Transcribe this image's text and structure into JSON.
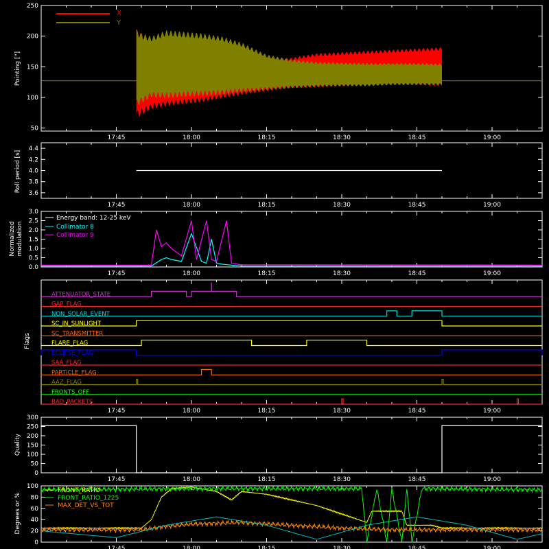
{
  "chart_data": [
    {
      "type": "area",
      "ylabel": "Pointing [\"]",
      "ylim": [
        45,
        250
      ],
      "yticks": [
        "50",
        "100",
        "150",
        "200",
        "250"
      ],
      "x_ticks": [
        "17:45",
        "18:00",
        "18:15",
        "18:30",
        "18:45",
        "19:00"
      ],
      "baseline": 127,
      "legend": [
        {
          "name": "X",
          "color": "#ff0000"
        },
        {
          "name": "Y",
          "color": "#808000"
        }
      ],
      "series": [
        {
          "name": "X",
          "color": "#ff0000",
          "x": [
            "17:49",
            "17:50",
            "17:52",
            "17:55",
            "17:58",
            "18:02",
            "18:06",
            "18:10",
            "18:15",
            "18:20",
            "18:25",
            "18:30",
            "18:35",
            "18:40",
            "18:45",
            "18:50"
          ],
          "upper": [
            210,
            205,
            195,
            192,
            188,
            182,
            178,
            172,
            162,
            165,
            172,
            174,
            176,
            178,
            180,
            182
          ],
          "lower": [
            65,
            70,
            80,
            85,
            88,
            92,
            98,
            104,
            110,
            115,
            116,
            118,
            120,
            120,
            120,
            118
          ]
        },
        {
          "name": "Y",
          "color": "#808000",
          "x": [
            "17:49",
            "17:50",
            "17:52",
            "17:55",
            "17:58",
            "18:02",
            "18:06",
            "18:10",
            "18:15",
            "18:20",
            "18:25",
            "18:30",
            "18:35",
            "18:40",
            "18:45",
            "18:50"
          ],
          "upper": [
            212,
            205,
            200,
            210,
            208,
            205,
            200,
            190,
            170,
            162,
            158,
            157,
            156,
            156,
            156,
            155
          ],
          "lower": [
            85,
            90,
            100,
            98,
            100,
            102,
            104,
            108,
            112,
            115,
            117,
            118,
            118,
            120,
            120,
            120
          ]
        }
      ]
    },
    {
      "type": "line",
      "ylabel": "Roll period [s]",
      "ylim": [
        3.5,
        4.5
      ],
      "yticks": [
        "3.6",
        "3.8",
        "4.0",
        "4.2",
        "4.4"
      ],
      "x_ticks": [
        "17:45",
        "18:00",
        "18:15",
        "18:30",
        "18:45",
        "19:00"
      ],
      "series": [
        {
          "color": "#ffffff",
          "x": [
            "17:49",
            "18:50"
          ],
          "y": [
            4.0,
            4.0
          ]
        }
      ]
    },
    {
      "type": "line",
      "ylabel": "Normalized modulation",
      "ylim": [
        0.0,
        3.0
      ],
      "yticks": [
        "0.0",
        "0.5",
        "1.0",
        "1.5",
        "2.0",
        "2.5",
        "3.0"
      ],
      "x_ticks": [
        "17:45",
        "18:00",
        "18:15",
        "18:30",
        "18:45",
        "19:00"
      ],
      "legend_title": "Energy band: 12-25 keV",
      "series": [
        {
          "name": "Collimator 8",
          "color": "#00ffff",
          "x": [
            "17:30",
            "17:52",
            "17:54",
            "17:55",
            "17:56",
            "17:58",
            "18:00",
            "18:02",
            "18:03",
            "18:04",
            "18:05",
            "18:06",
            "18:08",
            "18:10",
            "19:10"
          ],
          "y": [
            0.05,
            0.05,
            0.4,
            0.5,
            0.4,
            0.3,
            1.8,
            0.3,
            0.2,
            1.5,
            0.2,
            0.15,
            0.1,
            0.05,
            0.05
          ]
        },
        {
          "name": "Collimator 9",
          "color": "#ff00ff",
          "x": [
            "17:30",
            "17:52",
            "17:53",
            "17:54",
            "17:55",
            "17:56",
            "17:58",
            "18:00",
            "18:01",
            "18:03",
            "18:04",
            "18:05",
            "18:07",
            "18:08",
            "18:10",
            "19:10"
          ],
          "y": [
            0.1,
            0.1,
            2.0,
            1.1,
            1.3,
            1.0,
            0.6,
            2.5,
            0.4,
            2.5,
            0.4,
            0.3,
            2.5,
            0.2,
            0.12,
            0.1
          ]
        }
      ]
    },
    {
      "type": "table",
      "ylabel": "Flags",
      "x_ticks": [
        "17:45",
        "18:00",
        "18:15",
        "18:30",
        "18:45",
        "19:00"
      ],
      "flags": [
        {
          "label": "ATTENUATOR_STATE",
          "color": "#cc33cc",
          "on": [
            [
              "17:52",
              "17:59"
            ],
            [
              "18:00",
              "18:09"
            ]
          ],
          "step_up": [
            [
              "18:04",
              "18:04"
            ]
          ]
        },
        {
          "label": "GAP_FLAG",
          "color": "#ff2222",
          "on": []
        },
        {
          "label": "NON_SOLAR_EVENT",
          "color": "#00dddd",
          "on": [
            [
              "18:39",
              "18:41"
            ],
            [
              "18:44",
              "18:50"
            ]
          ]
        },
        {
          "label": "SC_IN_SUNLIGHT",
          "color": "#ffff00",
          "on": [
            [
              "17:49",
              "18:50"
            ]
          ]
        },
        {
          "label": "SC_TRANSMITTER",
          "color": "#ff6600",
          "on": []
        },
        {
          "label": "FLARE_FLAG",
          "color": "#ffff00",
          "on": [
            [
              "17:50",
              "18:12"
            ],
            [
              "18:23",
              "18:35"
            ]
          ]
        },
        {
          "label": "ECLIPSE_FLAG",
          "color": "#0000ff",
          "on": [
            [
              "17:30",
              "17:49"
            ],
            [
              "18:50",
              "19:10"
            ]
          ]
        },
        {
          "label": "SAA_FLAG",
          "color": "#ff2222",
          "on": []
        },
        {
          "label": "PARTICLE_FLAG",
          "color": "#ff6600",
          "on": [
            [
              "18:02",
              "18:04"
            ]
          ]
        },
        {
          "label": "AAZ_FLAG",
          "color": "#808000",
          "on": [
            [
              "17:49",
              "17:49"
            ],
            [
              "18:50",
              "18:50"
            ]
          ]
        },
        {
          "label": "FRONTS_OFF",
          "color": "#00ff00",
          "on": []
        },
        {
          "label": "BAD_PACKETS",
          "color": "#ff2222",
          "on": [
            [
              "18:30",
              "18:30"
            ],
            [
              "19:05",
              "19:05"
            ]
          ]
        }
      ]
    },
    {
      "type": "line",
      "ylabel": "Quality",
      "ylim": [
        0,
        300
      ],
      "yticks": [
        "0",
        "50",
        "100",
        "150",
        "200",
        "250",
        "300"
      ],
      "x_ticks": [
        "17:45",
        "18:00",
        "18:15",
        "18:30",
        "18:45",
        "19:00"
      ],
      "series": [
        {
          "color": "#ffffff",
          "x": [
            "17:30",
            "17:49",
            "17:49",
            "18:50",
            "18:50",
            "19:10"
          ],
          "y": [
            255,
            255,
            0,
            0,
            255,
            255
          ]
        }
      ]
    },
    {
      "type": "line",
      "ylabel": "Degrees or %",
      "ylim": [
        0,
        100
      ],
      "yticks": [
        "0",
        "20",
        "40",
        "60",
        "80",
        "100"
      ],
      "x_ticks": [
        "17:45",
        "18:00",
        "18:15",
        "18:30",
        "18:45",
        "19:00"
      ],
      "series": [
        {
          "name": "FRONT_RATIO",
          "color": "#ffff00",
          "x": [
            "17:30",
            "17:50",
            "17:52",
            "17:54",
            "17:56",
            "18:00",
            "18:05",
            "18:08",
            "18:10",
            "18:15",
            "18:20",
            "18:25",
            "18:30",
            "18:35",
            "18:36",
            "18:42",
            "18:43",
            "18:48",
            "18:50",
            "19:10"
          ],
          "y": [
            25,
            25,
            40,
            80,
            95,
            98,
            90,
            75,
            90,
            85,
            75,
            65,
            50,
            35,
            55,
            55,
            30,
            30,
            25,
            25
          ]
        },
        {
          "name": "FRONT_RATIO_1225",
          "color": "#00ff00",
          "x": [
            "17:30",
            "18:00",
            "18:34",
            "18:35",
            "18:37",
            "18:39",
            "18:40",
            "18:42",
            "18:43",
            "18:44",
            "18:46",
            "19:10"
          ],
          "y": [
            93,
            95,
            95,
            0,
            95,
            0,
            95,
            0,
            95,
            0,
            95,
            93
          ]
        },
        {
          "name": "MAX_DET_VS_TOT",
          "color": "#ff8800",
          "x": [
            "17:30",
            "17:50",
            "17:55",
            "18:00",
            "18:10",
            "18:20",
            "18:30",
            "18:40",
            "18:50",
            "19:10"
          ],
          "y": [
            22,
            22,
            28,
            32,
            35,
            30,
            25,
            22,
            22,
            22
          ]
        },
        {
          "color": "#00bbbb",
          "x": [
            "17:30",
            "17:45",
            "17:55",
            "18:05",
            "18:15",
            "18:25",
            "18:35",
            "18:45",
            "18:55",
            "19:05",
            "19:10"
          ],
          "y": [
            20,
            8,
            30,
            45,
            30,
            5,
            30,
            45,
            30,
            5,
            15
          ]
        }
      ]
    }
  ]
}
